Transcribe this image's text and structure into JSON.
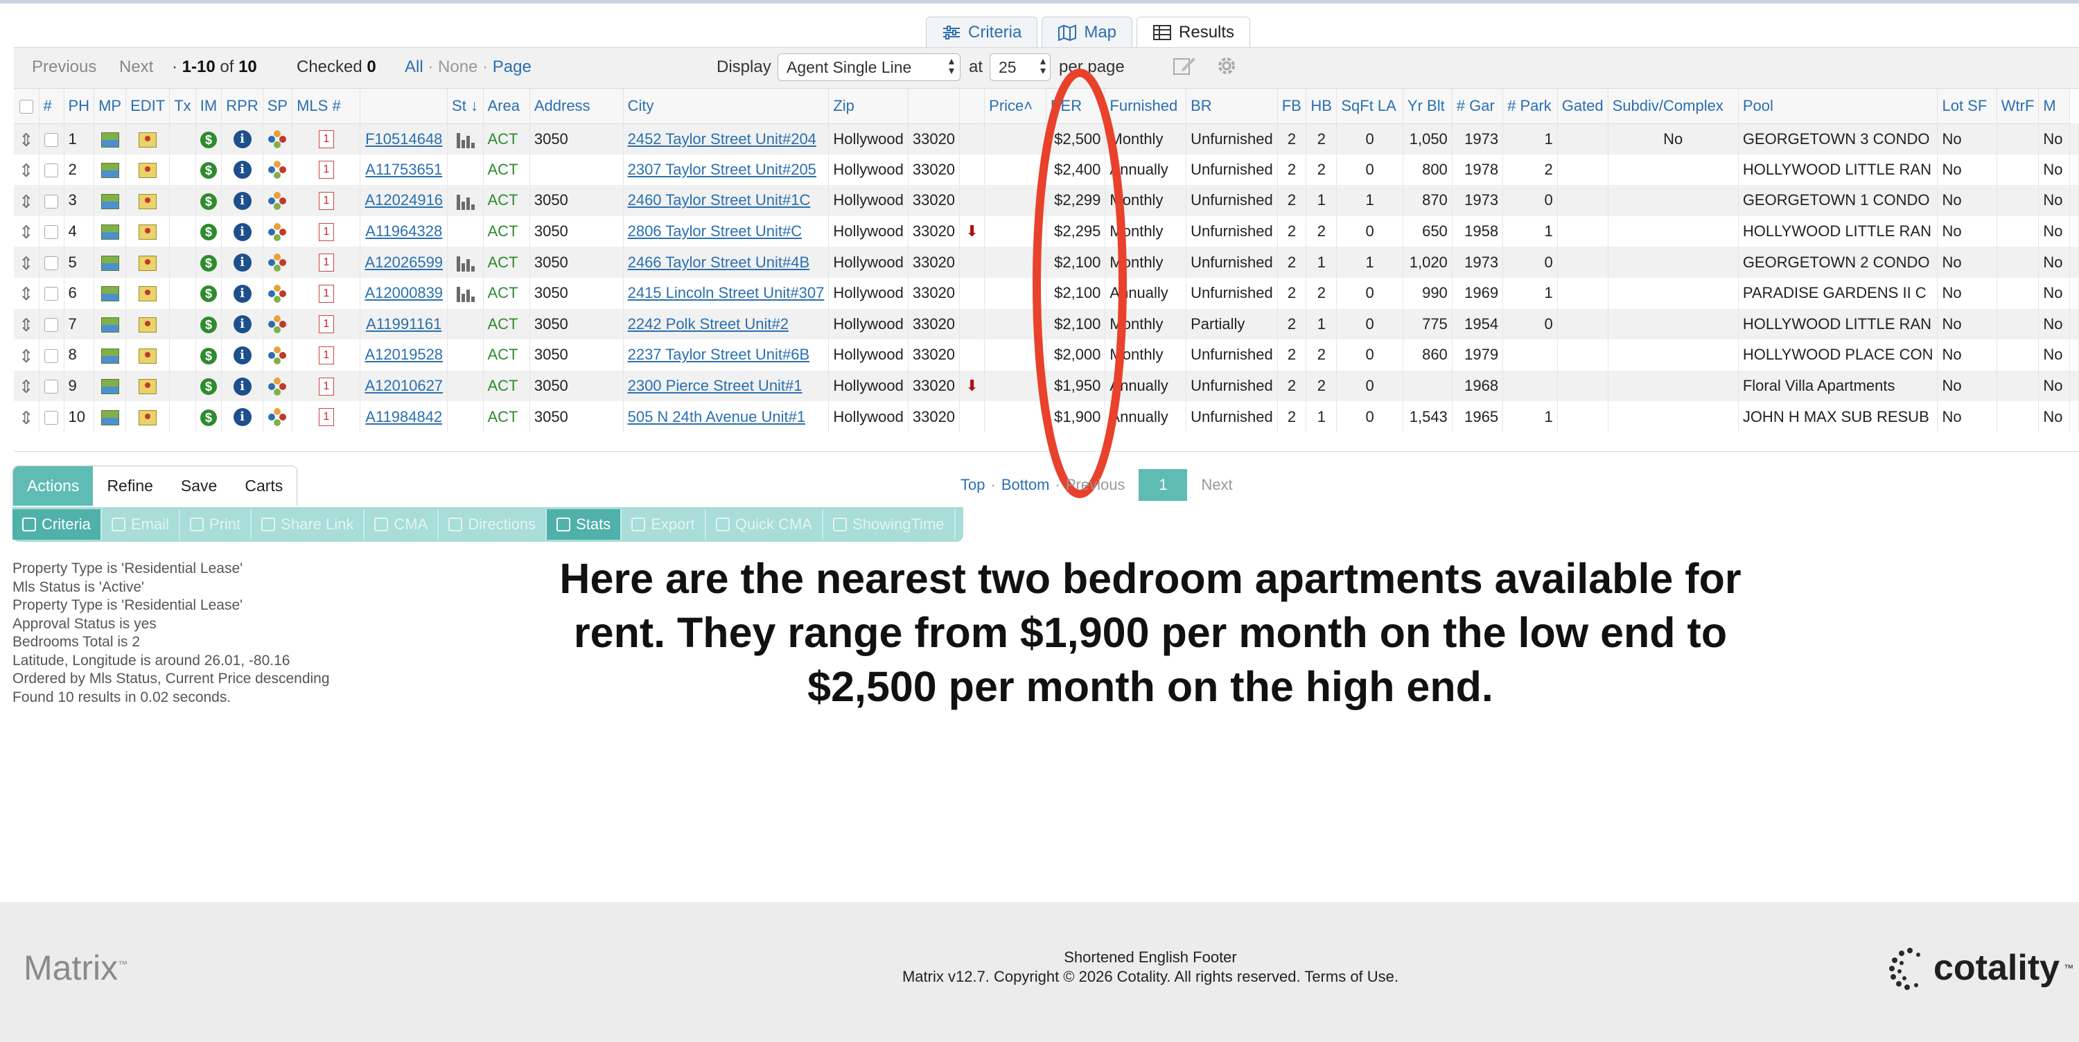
{
  "view_tabs": [
    {
      "label": "Criteria",
      "icon": "sliders-icon"
    },
    {
      "label": "Map",
      "icon": "map-icon"
    },
    {
      "label": "Results",
      "icon": "grid-icon"
    }
  ],
  "toolbar": {
    "previous": "Previous",
    "next": "Next",
    "range_prefix": "·",
    "range_value": "1-10",
    "range_of": "of",
    "range_total": "10",
    "checked_label": "Checked",
    "checked_value": "0",
    "select_all": "All",
    "select_none": "None",
    "select_page": "Page",
    "display_label": "Display",
    "display_value": "Agent Single Line",
    "at_label": "at",
    "per_page_value": "25",
    "per_page_label": "per page"
  },
  "columns": [
    "",
    "#",
    "PH",
    "MP",
    "EDIT",
    "Tx",
    "IM",
    "RPR",
    "SP",
    "MLS #",
    "",
    "St",
    "Area",
    "Address",
    "City",
    "Zip",
    "",
    "",
    "Price",
    "PER",
    "Furnished",
    "BR",
    "FB",
    "HB",
    "SqFt LA",
    "Yr Blt",
    "# Gar",
    "# Park",
    "Gated",
    "Subdiv/Complex",
    "Pool",
    "Lot SF",
    "WtrF",
    "M"
  ],
  "rows": [
    {
      "n": "1",
      "mls": "F10514648",
      "hist": true,
      "st": "ACT",
      "area": "3050",
      "address": "2452 Taylor Street Unit#204",
      "city": "Hollywood",
      "zip": "33020",
      "down": false,
      "price": "$2,500",
      "per": "Monthly",
      "furnished": "Unfurnished",
      "br": "2",
      "fb": "2",
      "hb": "0",
      "sqft": "1,050",
      "yr": "1973",
      "gar": "1",
      "park": "",
      "gated": "No",
      "subdiv": "GEORGETOWN 3 CONDO",
      "pool": "No",
      "lot": "",
      "wtrf": "No"
    },
    {
      "n": "2",
      "mls": "A11753651",
      "hist": false,
      "st": "ACT",
      "area": "",
      "address": "2307 Taylor Street Unit#205",
      "city": "Hollywood",
      "zip": "33020",
      "down": false,
      "price": "$2,400",
      "per": "Annually",
      "furnished": "Unfurnished",
      "br": "2",
      "fb": "2",
      "hb": "0",
      "sqft": "800",
      "yr": "1978",
      "gar": "2",
      "park": "",
      "gated": "",
      "subdiv": "HOLLYWOOD LITTLE RAN",
      "pool": "No",
      "lot": "",
      "wtrf": "No"
    },
    {
      "n": "3",
      "mls": "A12024916",
      "hist": true,
      "st": "ACT",
      "area": "3050",
      "address": "2460 Taylor Street Unit#1C",
      "city": "Hollywood",
      "zip": "33020",
      "down": false,
      "price": "$2,299",
      "per": "Monthly",
      "furnished": "Unfurnished",
      "br": "2",
      "fb": "1",
      "hb": "1",
      "sqft": "870",
      "yr": "1973",
      "gar": "0",
      "park": "",
      "gated": "",
      "subdiv": "GEORGETOWN 1 CONDO",
      "pool": "No",
      "lot": "",
      "wtrf": "No"
    },
    {
      "n": "4",
      "mls": "A11964328",
      "hist": false,
      "st": "ACT",
      "area": "3050",
      "address": "2806 Taylor Street Unit#C",
      "city": "Hollywood",
      "zip": "33020",
      "down": true,
      "price": "$2,295",
      "per": "Monthly",
      "furnished": "Unfurnished",
      "br": "2",
      "fb": "2",
      "hb": "0",
      "sqft": "650",
      "yr": "1958",
      "gar": "1",
      "park": "",
      "gated": "",
      "subdiv": "HOLLYWOOD LITTLE RAN",
      "pool": "No",
      "lot": "",
      "wtrf": "No"
    },
    {
      "n": "5",
      "mls": "A12026599",
      "hist": true,
      "st": "ACT",
      "area": "3050",
      "address": "2466 Taylor Street Unit#4B",
      "city": "Hollywood",
      "zip": "33020",
      "down": false,
      "price": "$2,100",
      "per": "Monthly",
      "furnished": "Unfurnished",
      "br": "2",
      "fb": "1",
      "hb": "1",
      "sqft": "1,020",
      "yr": "1973",
      "gar": "0",
      "park": "",
      "gated": "",
      "subdiv": "GEORGETOWN 2 CONDO",
      "pool": "No",
      "lot": "",
      "wtrf": "No"
    },
    {
      "n": "6",
      "mls": "A12000839",
      "hist": true,
      "st": "ACT",
      "area": "3050",
      "address": "2415 Lincoln Street Unit#307",
      "city": "Hollywood",
      "zip": "33020",
      "down": false,
      "price": "$2,100",
      "per": "Annually",
      "furnished": "Unfurnished",
      "br": "2",
      "fb": "2",
      "hb": "0",
      "sqft": "990",
      "yr": "1969",
      "gar": "1",
      "park": "",
      "gated": "",
      "subdiv": "PARADISE GARDENS II C",
      "pool": "No",
      "lot": "",
      "wtrf": "No"
    },
    {
      "n": "7",
      "mls": "A11991161",
      "hist": false,
      "st": "ACT",
      "area": "3050",
      "address": "2242 Polk Street Unit#2",
      "city": "Hollywood",
      "zip": "33020",
      "down": false,
      "price": "$2,100",
      "per": "Monthly",
      "furnished": "Partially",
      "br": "2",
      "fb": "1",
      "hb": "0",
      "sqft": "775",
      "yr": "1954",
      "gar": "0",
      "park": "",
      "gated": "",
      "subdiv": "HOLLYWOOD LITTLE RAN",
      "pool": "No",
      "lot": "",
      "wtrf": "No"
    },
    {
      "n": "8",
      "mls": "A12019528",
      "hist": false,
      "st": "ACT",
      "area": "3050",
      "address": "2237 Taylor Street Unit#6B",
      "city": "Hollywood",
      "zip": "33020",
      "down": false,
      "price": "$2,000",
      "per": "Monthly",
      "furnished": "Unfurnished",
      "br": "2",
      "fb": "2",
      "hb": "0",
      "sqft": "860",
      "yr": "1979",
      "gar": "",
      "park": "",
      "gated": "",
      "subdiv": "HOLLYWOOD PLACE CON",
      "pool": "No",
      "lot": "",
      "wtrf": "No"
    },
    {
      "n": "9",
      "mls": "A12010627",
      "hist": false,
      "st": "ACT",
      "area": "3050",
      "address": "2300 Pierce Street Unit#1",
      "city": "Hollywood",
      "zip": "33020",
      "down": true,
      "price": "$1,950",
      "per": "Annually",
      "furnished": "Unfurnished",
      "br": "2",
      "fb": "2",
      "hb": "0",
      "sqft": "",
      "yr": "1968",
      "gar": "",
      "park": "",
      "gated": "",
      "subdiv": "Floral Villa Apartments",
      "pool": "No",
      "lot": "",
      "wtrf": "No"
    },
    {
      "n": "10",
      "mls": "A11984842",
      "hist": false,
      "st": "ACT",
      "area": "3050",
      "address": "505 N 24th Avenue Unit#1",
      "city": "Hollywood",
      "zip": "33020",
      "down": false,
      "price": "$1,900",
      "per": "Annually",
      "furnished": "Unfurnished",
      "br": "2",
      "fb": "1",
      "hb": "0",
      "sqft": "1,543",
      "yr": "1965",
      "gar": "1",
      "park": "",
      "gated": "",
      "subdiv": "JOHN H MAX SUB RESUB",
      "pool": "No",
      "lot": "",
      "wtrf": "No"
    }
  ],
  "pager": {
    "top": "Top",
    "bottom": "Bottom",
    "previous": "Previous",
    "page": "1",
    "next": "Next"
  },
  "action_tabs": [
    "Actions",
    "Refine",
    "Save",
    "Carts"
  ],
  "action_buttons": [
    {
      "label": "Criteria",
      "icon": "search-icon",
      "active": true
    },
    {
      "label": "Email",
      "icon": "email-icon",
      "active": false
    },
    {
      "label": "Print",
      "icon": "print-icon",
      "active": false
    },
    {
      "label": "Share Link",
      "icon": "link-icon",
      "active": false
    },
    {
      "label": "CMA",
      "icon": "document-icon",
      "active": false
    },
    {
      "label": "Directions",
      "icon": "directions-icon",
      "active": false
    },
    {
      "label": "Stats",
      "icon": "chart-icon",
      "active": true
    },
    {
      "label": "Export",
      "icon": "export-icon",
      "active": false
    },
    {
      "label": "Quick CMA",
      "icon": "document-icon",
      "active": false
    },
    {
      "label": "ShowingTime",
      "icon": "calendar-icon",
      "active": false
    }
  ],
  "criteria": [
    "Property Type is 'Residential Lease'",
    "Mls Status is 'Active'",
    "Property Type is 'Residential Lease'",
    "Approval Status is yes",
    "Bedrooms Total is 2",
    "Latitude, Longitude is around 26.01, -80.16",
    "Ordered by Mls Status, Current Price descending",
    "Found 10 results in 0.02 seconds."
  ],
  "caption": {
    "line1": "Here are the nearest two bedroom apartments available for",
    "line2": "rent. They range from $1,900 per month on the low end to",
    "line3": "$2,500 per month on the high end."
  },
  "footer": {
    "logo": "Matrix",
    "logo_tm": "™",
    "line1": "Shortened English Footer",
    "line2_prefix": "Matrix v12.7. Copyright © 2026 Cotality. All rights reserved.",
    "terms": "Terms of Use.",
    "brand": "cotality",
    "brand_tm": "™"
  },
  "colors": {
    "link": "#2a6fb0",
    "teal": "#5fbcb5",
    "annotation": "#e8412c",
    "active_status": "#2f8a2f"
  }
}
